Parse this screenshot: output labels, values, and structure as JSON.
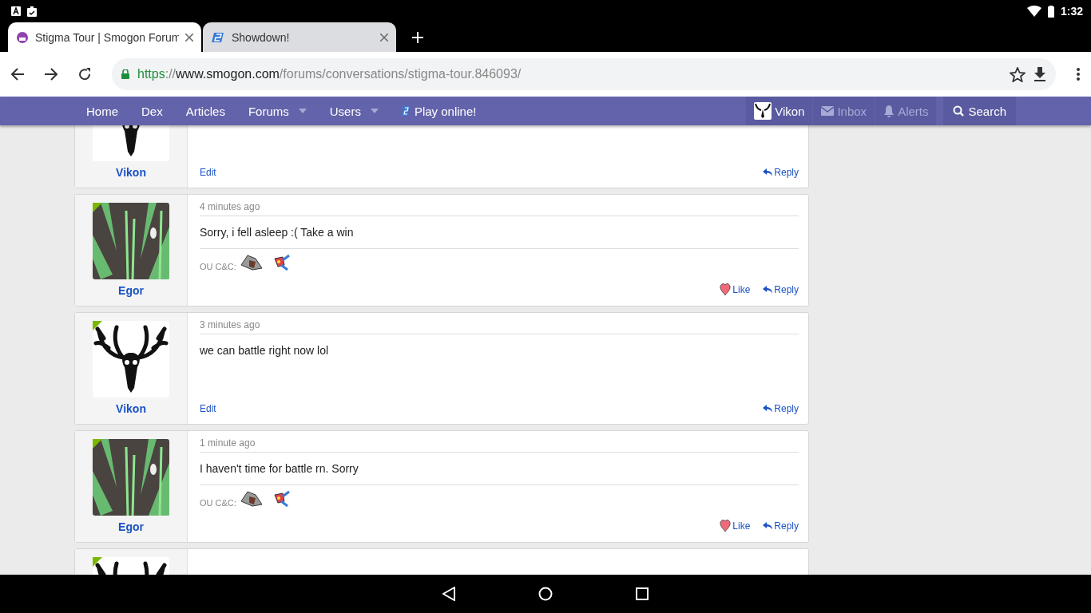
{
  "status_bar": {
    "time": "1:32"
  },
  "browser_tabs": [
    {
      "title": "Stigma Tour | Smogon Forum",
      "selected": true
    },
    {
      "title": "Showdown!",
      "selected": false
    }
  ],
  "address_bar": {
    "scheme": "https",
    "separator": "://",
    "host": "www.smogon.com",
    "path": "/forums/conversations/stigma-tour.846093/"
  },
  "site_nav": {
    "items": [
      {
        "label": "Home",
        "kind": "plain"
      },
      {
        "label": "Dex",
        "kind": "plain"
      },
      {
        "label": "Articles",
        "kind": "plain"
      },
      {
        "label": "Forums",
        "kind": "dropdown"
      },
      {
        "label": "Users",
        "kind": "dropdown"
      },
      {
        "label": "Play online!",
        "kind": "showdown"
      }
    ],
    "account": [
      {
        "label": "Vikon",
        "kind": "avatar",
        "disabled": false
      },
      {
        "label": "Inbox",
        "kind": "inbox",
        "disabled": true
      },
      {
        "label": "Alerts",
        "kind": "alerts",
        "disabled": true
      }
    ],
    "search": "Search"
  },
  "posts": [
    {
      "kind": "skull",
      "author": "Vikon",
      "actions": [
        {
          "label": "Edit",
          "kind": "edit"
        },
        {
          "label": "Reply",
          "kind": "reply"
        }
      ]
    },
    {
      "kind": "abstract",
      "author": "Egor",
      "online": true,
      "time": "4 minutes ago",
      "message": "Sorry, i fell asleep :( Take a win",
      "signature": "OU C&C:",
      "actions": [
        {
          "label": "Like",
          "kind": "like"
        },
        {
          "label": "Reply",
          "kind": "reply"
        }
      ]
    },
    {
      "kind": "skull",
      "author": "Vikon",
      "online": true,
      "time": "3 minutes ago",
      "message": "we can battle right now lol",
      "actions": [
        {
          "label": "Edit",
          "kind": "edit"
        },
        {
          "label": "Reply",
          "kind": "reply"
        }
      ]
    },
    {
      "kind": "abstract",
      "author": "Egor",
      "online": true,
      "time": "1 minute ago",
      "message": "I haven't time for battle rn. Sorry",
      "signature": "OU C&C:",
      "actions": [
        {
          "label": "Like",
          "kind": "like"
        },
        {
          "label": "Reply",
          "kind": "reply"
        }
      ]
    },
    {
      "kind": "skull",
      "online": true
    }
  ]
}
